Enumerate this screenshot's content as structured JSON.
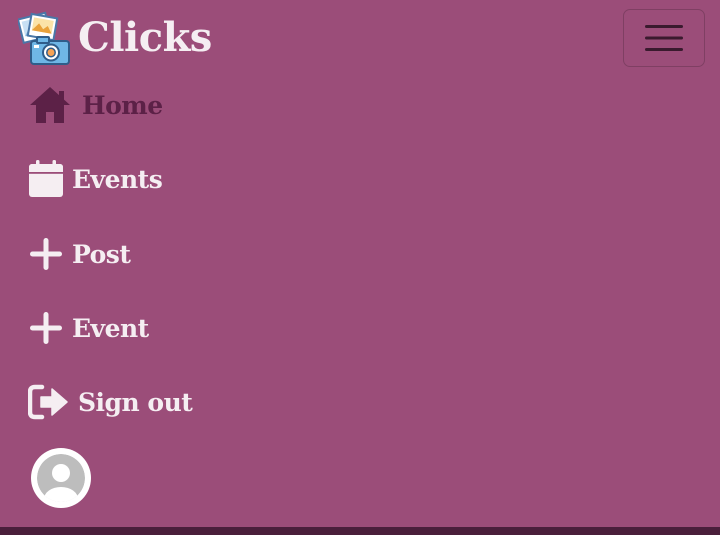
{
  "brand": {
    "title": "Clicks",
    "logo_icon": "camera-photos-logo-icon"
  },
  "toggler": {
    "icon": "hamburger-menu-icon"
  },
  "nav": {
    "items": [
      {
        "label": "Home",
        "icon": "home-icon",
        "active": true
      },
      {
        "label": "Events",
        "icon": "calendar-icon",
        "active": false
      },
      {
        "label": "Post",
        "icon": "plus-icon",
        "active": false
      },
      {
        "label": "Event",
        "icon": "plus-icon",
        "active": false
      },
      {
        "label": "Sign out",
        "icon": "sign-out-icon",
        "active": false
      }
    ]
  },
  "profile": {
    "avatar_icon": "user-avatar-icon"
  },
  "colors": {
    "background": "#9b4d79",
    "active_text": "#5c2147",
    "text": "#f5eef2",
    "bottom_bar": "#4a1f3b"
  }
}
